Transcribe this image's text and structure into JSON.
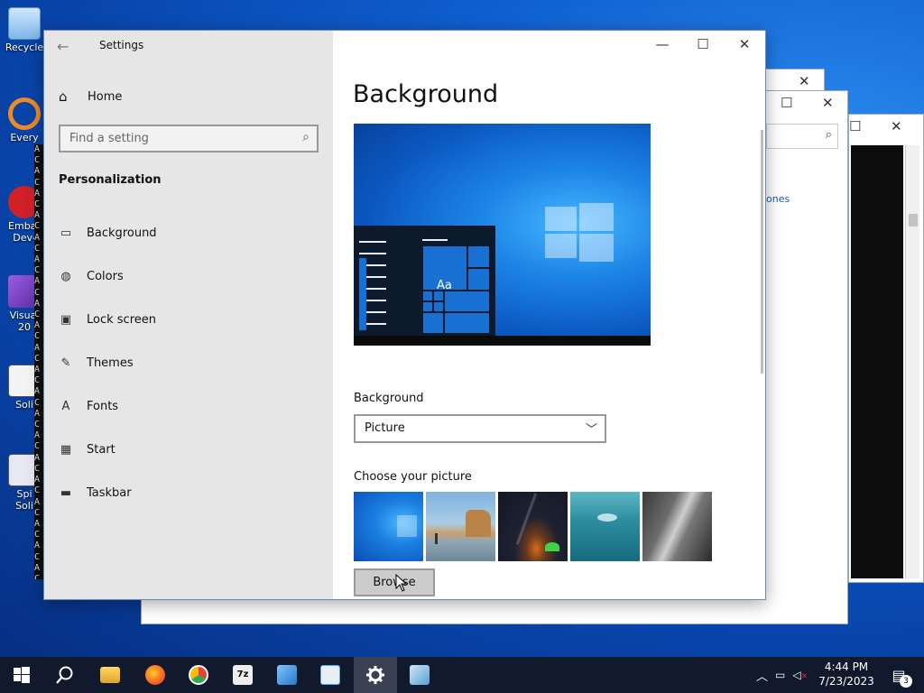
{
  "desktop": {
    "icons": [
      {
        "label": "Recycle",
        "icon": "recycle-bin-icon"
      },
      {
        "label": "Every",
        "icon": "everything-icon"
      },
      {
        "label": "Embar",
        "sub": "Dev-",
        "icon": "embarcadero-icon"
      },
      {
        "label": "Visual",
        "sub": "20",
        "icon": "visual-studio-icon"
      },
      {
        "label": "Soli",
        "icon": "solitaire-icon"
      },
      {
        "label": "Spi",
        "sub": "Soli",
        "icon": "spider-solitaire-icon"
      }
    ],
    "console_chars": [
      "A",
      "C",
      "A",
      "C",
      "A",
      "C",
      "A",
      "C",
      "A",
      "C",
      "A",
      "C",
      "A",
      "C",
      "A",
      "C",
      "A",
      "C",
      "A",
      "C",
      "A",
      "C",
      "A",
      "C",
      "A",
      "C",
      "A",
      "C",
      "A",
      "C",
      "A",
      "C",
      "A",
      "C",
      "A",
      "C",
      "A",
      "C",
      "A",
      "C"
    ],
    "background_window_link": "ones"
  },
  "settings": {
    "title": "Settings",
    "back_icon": "back-arrow-icon",
    "controls": {
      "minimize": "—",
      "maximize": "☐",
      "close": "✕"
    },
    "nav": {
      "home_label": "Home",
      "search_placeholder": "Find a setting",
      "section_title": "Personalization",
      "items": [
        {
          "label": "Background",
          "icon": "picture-icon"
        },
        {
          "label": "Colors",
          "icon": "palette-icon"
        },
        {
          "label": "Lock screen",
          "icon": "lock-screen-icon"
        },
        {
          "label": "Themes",
          "icon": "themes-icon"
        },
        {
          "label": "Fonts",
          "icon": "fonts-icon"
        },
        {
          "label": "Start",
          "icon": "start-icon"
        },
        {
          "label": "Taskbar",
          "icon": "taskbar-icon"
        }
      ]
    },
    "content": {
      "title": "Background",
      "preview_tile_text": "Aa",
      "background_label": "Background",
      "background_value": "Picture",
      "choose_picture_label": "Choose your picture",
      "browse_label": "Browse"
    }
  },
  "taskbar": {
    "apps": [
      {
        "name": "start-button",
        "icon": "windows-logo-icon"
      },
      {
        "name": "search-button",
        "icon": "search-icon"
      },
      {
        "name": "file-explorer",
        "icon": "folder-icon"
      },
      {
        "name": "firefox",
        "icon": "firefox-icon"
      },
      {
        "name": "chrome",
        "icon": "chrome-icon"
      },
      {
        "name": "7zip",
        "icon": "7zip-icon"
      },
      {
        "name": "control-panel",
        "icon": "control-panel-icon"
      },
      {
        "name": "notepad",
        "icon": "notepad-icon"
      },
      {
        "name": "settings",
        "icon": "gear-icon"
      },
      {
        "name": "task-scheduler",
        "icon": "task-icon"
      }
    ],
    "time": "4:44 PM",
    "date": "7/23/2023",
    "notification_count": "3"
  }
}
